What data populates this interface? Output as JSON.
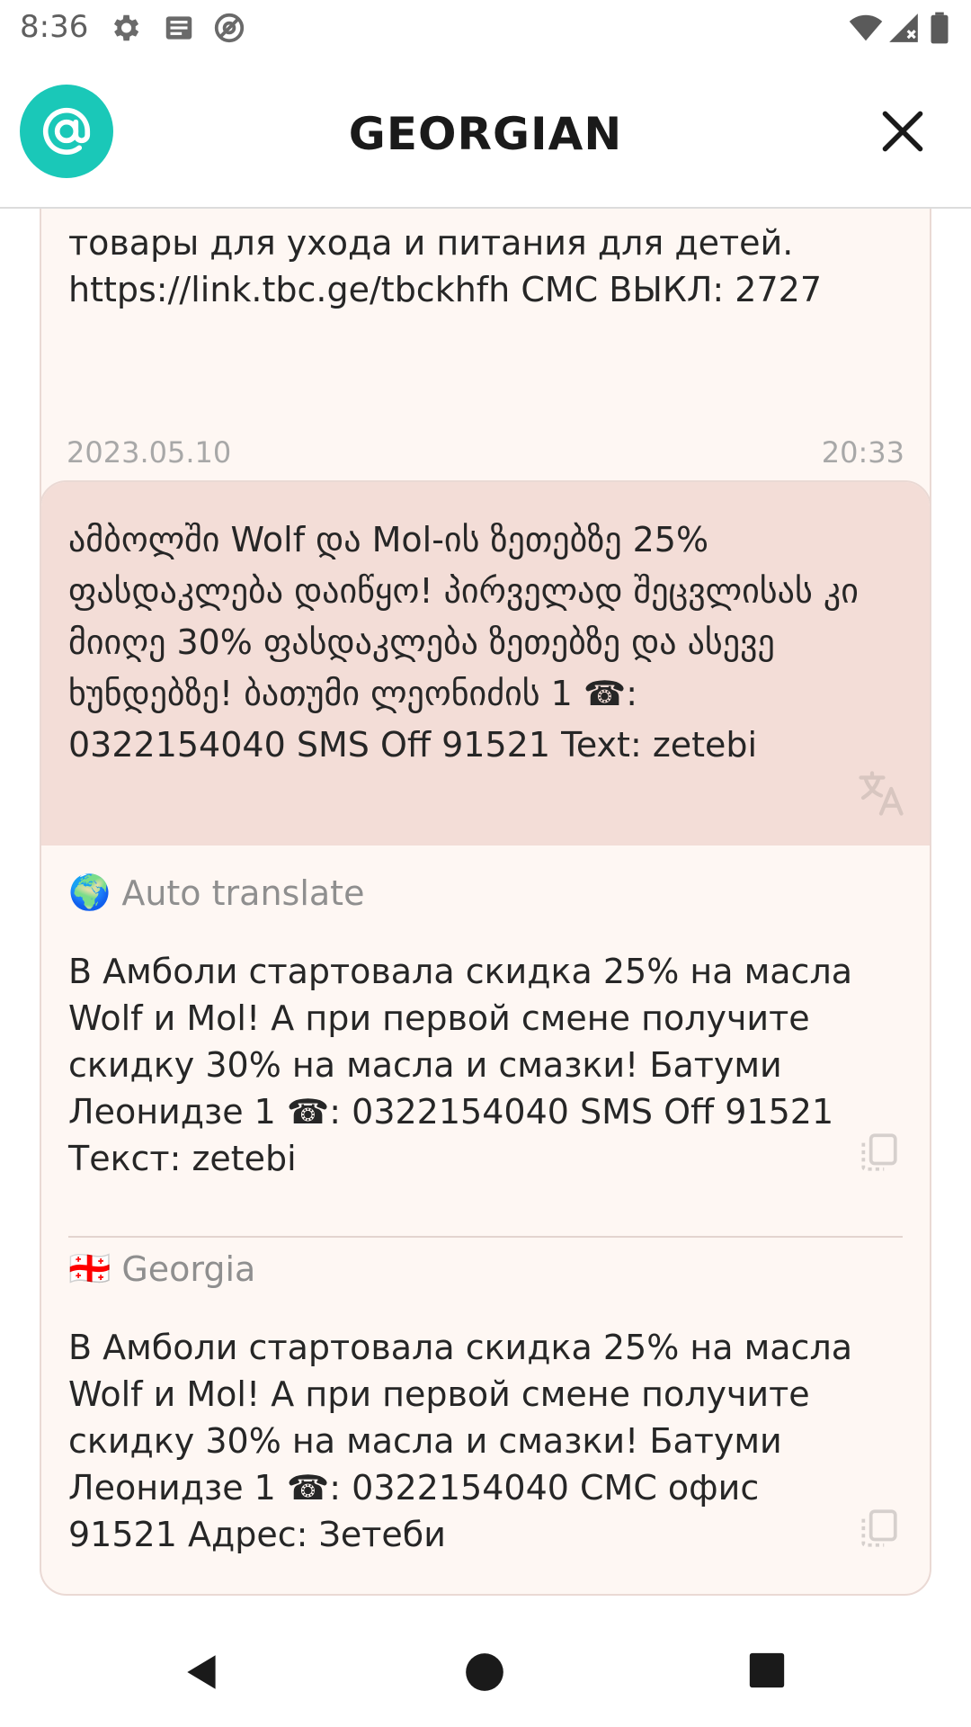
{
  "status_bar": {
    "time": "8:36",
    "icons": [
      "gear-icon",
      "news-icon",
      "at-sync-icon",
      "wifi-icon",
      "signal-icon",
      "battery-icon"
    ]
  },
  "header": {
    "title": "GEORGIAN",
    "logo_icon": "at-icon",
    "close_icon": "close-icon",
    "accent_color": "#1ac8b8"
  },
  "messages": [
    {
      "text": "товары для ухода и питания для детей. https://link.tbc.ge/tbckhfh СМС ВЫКЛ: 2727"
    },
    {
      "date": "2023.05.10",
      "time": "20:33",
      "original": "ამბოლში Wolf და Mol-ის ზეთებზე 25% ფასდაკლება დაიწყო! პირველად შეცვლისას კი მიიღე 30% ფასდაკლება ზეთებზე და ასევე ხუნდებზე! ბათუმი ლეონიძის 1 ☎: 0322154040 SMS Off 91521 Text: zetebi",
      "translations": [
        {
          "flag": "🌍",
          "label": "Auto translate",
          "text": "В Амболи стартовала скидка 25% на масла Wolf и Mol! А при первой смене получите скидку 30% на масла и смазки! Батуми Леонидзе 1 ☎: 0322154040 SMS Off 91521 Текст: zetebi"
        },
        {
          "flag": "🇬🇪",
          "label": "Georgia",
          "text": "В Амболи стартовала скидка 25% на масла Wolf и Mol! А при первой смене получите скидку 30% на масла и смазки! Батуми Леонидзе 1 ☎: 0322154040 СМС офис 91521 Адрес: Зетеби"
        }
      ]
    }
  ],
  "colors": {
    "card_bg": "#fef7f3",
    "original_bg": "#f3ddd7",
    "muted_text": "#a8a8a8"
  }
}
